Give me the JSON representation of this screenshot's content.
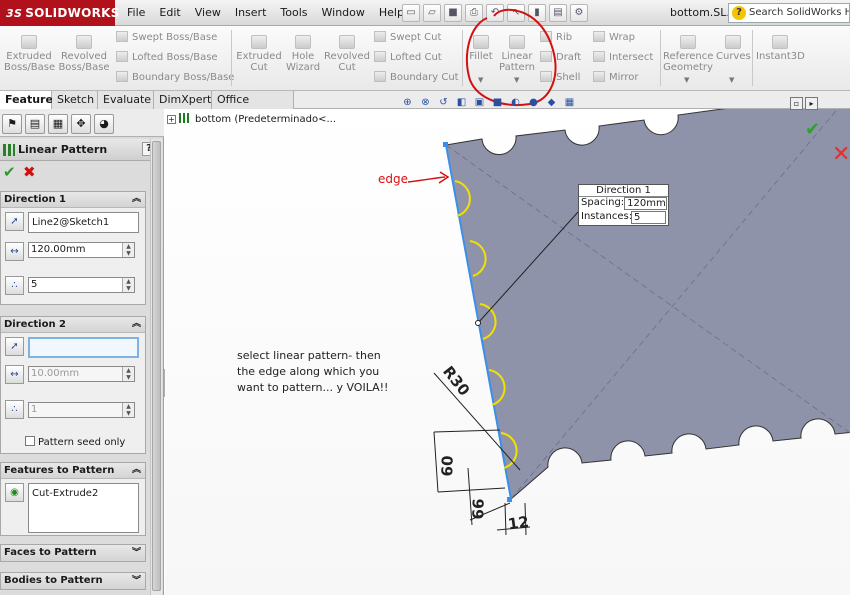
{
  "app": {
    "logo_prefix": "3S",
    "logo": "SOLIDWORKS",
    "doc_title": "bottom.SL...",
    "search_placeholder": "Search SolidWorks Hel"
  },
  "menu": [
    "File",
    "Edit",
    "View",
    "Insert",
    "Tools",
    "Window",
    "Help"
  ],
  "ribbon": {
    "extruded_boss": "Extruded\nBoss/Base",
    "revolved_boss": "Revolved\nBoss/Base",
    "swept_boss": "Swept Boss/Base",
    "lofted_boss": "Lofted Boss/Base",
    "boundary_boss": "Boundary Boss/Base",
    "extruded_cut": "Extruded\nCut",
    "hole_wizard": "Hole\nWizard",
    "revolved_cut": "Revolved\nCut",
    "swept_cut": "Swept Cut",
    "lofted_cut": "Lofted Cut",
    "boundary_cut": "Boundary Cut",
    "fillet": "Fillet",
    "linear_pattern": "Linear\nPattern",
    "rib": "Rib",
    "draft": "Draft",
    "shell": "Shell",
    "wrap": "Wrap",
    "intersect": "Intersect",
    "mirror": "Mirror",
    "reference_geometry": "Reference\nGeometry",
    "curves": "Curves",
    "instant3d": "Instant3D"
  },
  "tabs": [
    "Features",
    "Sketch",
    "Evaluate",
    "DimXpert",
    "Office Products"
  ],
  "property_manager": {
    "title": "Linear Pattern",
    "help": "?",
    "direction1": {
      "title": "Direction 1",
      "edge": "Line2@Sketch1",
      "spacing": "120.00mm",
      "instances": "5"
    },
    "direction2": {
      "title": "Direction 2",
      "edge": "",
      "spacing": "10.00mm",
      "instances": "1",
      "seed_only": "Pattern seed only"
    },
    "features": {
      "title": "Features to Pattern",
      "item": "Cut-Extrude2"
    },
    "faces": {
      "title": "Faces to Pattern"
    },
    "bodies": {
      "title": "Bodies to Pattern"
    }
  },
  "tree": {
    "root": "bottom  (Predeterminado<..."
  },
  "callout": {
    "title": "Direction 1",
    "spacing_label": "Spacing:",
    "spacing_value": "120mm",
    "instances_label": "Instances:",
    "instances_value": "5"
  },
  "annotation": "select linear pattern- then the edge along which you want to pattern... y VOILA!!",
  "edge_label": "edge",
  "dimensions": {
    "radius": "R30",
    "d60": "60",
    "d66": "66",
    "d12": "12"
  },
  "colors": {
    "part_face": "#8e93aa",
    "selected_edge": "#3b8fe8",
    "preview": "#f2e000",
    "annotation_red": "#d11111",
    "logo_red": "#b1111a"
  }
}
